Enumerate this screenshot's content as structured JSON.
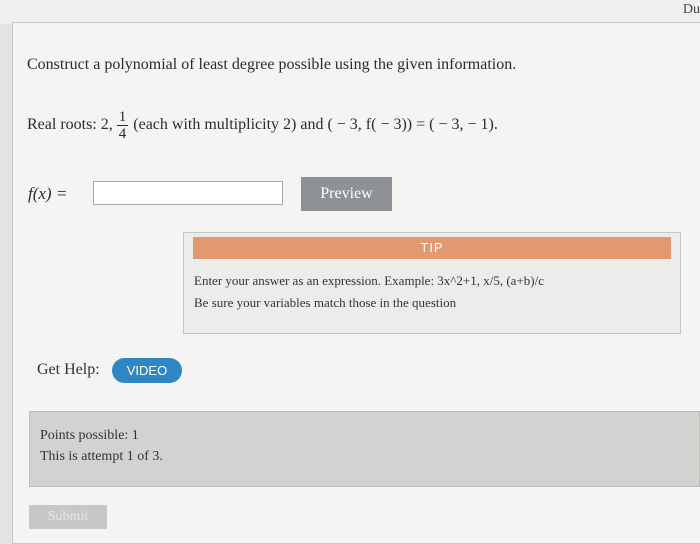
{
  "corner": {
    "text": "Du"
  },
  "question": {
    "prompt": "Construct a polynomial of least degree possible using the given information.",
    "roots_prefix": "Real roots: 2, ",
    "fraction_numerator": "1",
    "fraction_denominator": "4",
    "roots_suffix": " (each with multiplicity 2) and ( − 3, f( − 3)) = ( − 3,  − 1)."
  },
  "answer": {
    "label": "f(x) =",
    "value": ""
  },
  "buttons": {
    "preview": "Preview",
    "video": "VIDEO",
    "submit": "Submit"
  },
  "tip": {
    "header": "TIP",
    "line1": "Enter your answer as an expression. Example: 3x^2+1, x/5, (a+b)/c",
    "line2": "Be sure your variables match those in the question"
  },
  "help": {
    "label": "Get Help:"
  },
  "points": {
    "possible": "Points possible: 1",
    "attempt": "This is attempt 1 of 3."
  }
}
